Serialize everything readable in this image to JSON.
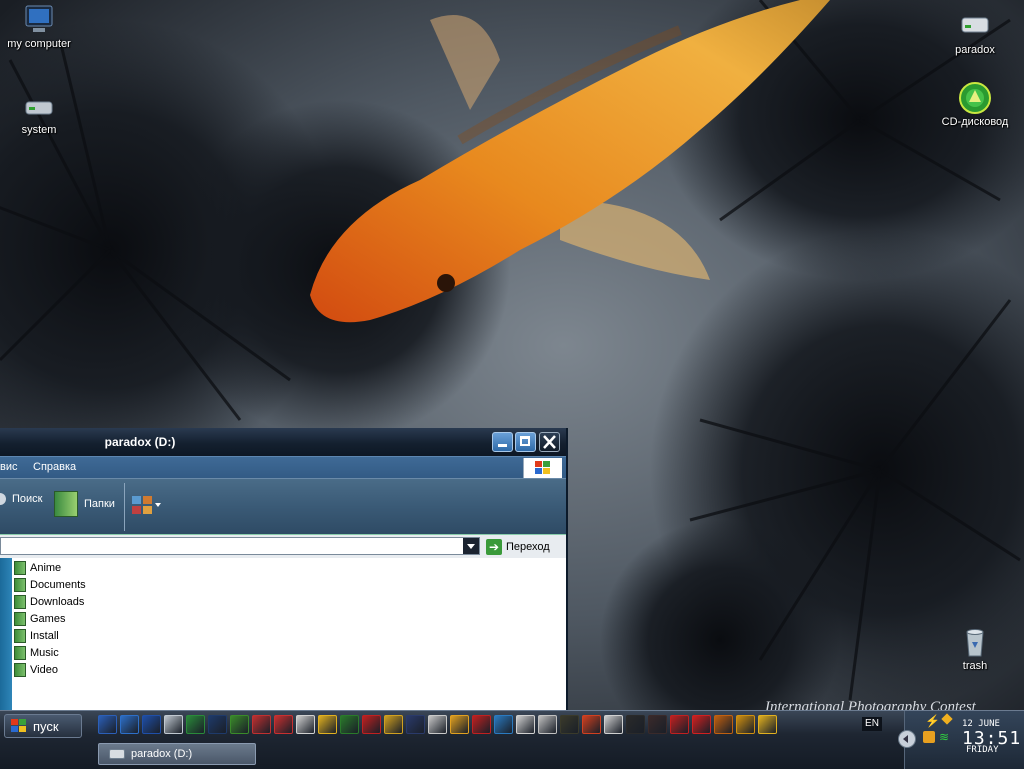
{
  "desktop": {
    "icons": [
      {
        "label": "my computer",
        "icon": "monitor-icon"
      },
      {
        "label": "system",
        "icon": "hard-drive-icon"
      },
      {
        "label": "paradox",
        "icon": "hard-drive-icon"
      },
      {
        "label": "CD-дисковод",
        "icon": "cd-drive-icon"
      },
      {
        "label": "trash",
        "icon": "recycle-bin-icon"
      }
    ],
    "wallpaper_watermark": "International Photography Contest"
  },
  "explorer": {
    "title": "paradox (D:)",
    "menu": [
      "вис",
      "Справка"
    ],
    "toolbar": {
      "search_label": "Поиск",
      "folders_label": "Папки"
    },
    "address": {
      "value": "",
      "go_label": "Переход"
    },
    "folders": [
      "Anime",
      "Documents",
      "Downloads",
      "Games",
      "Install",
      "Music",
      "Video"
    ]
  },
  "taskbar": {
    "start_label": "пуск",
    "language": "EN",
    "task_button_label": "paradox (D:)",
    "clock": {
      "date": "12 JUNE",
      "time": "13:51",
      "day": "FRIDAY"
    },
    "quicklaunch_colors": [
      "#2b5fb8",
      "#2d6fc8",
      "#1f4fa8",
      "#c0c8d0",
      "#2a8a3a",
      "#1e3a6a",
      "#3a8a2a",
      "#c03030",
      "#c83030",
      "#d0d0d0",
      "#e0b020",
      "#2a7a2a",
      "#c02020",
      "#d0a020",
      "#2a3a6a",
      "#c8c8c8",
      "#e0a020",
      "#c02020",
      "#2a7ac0",
      "#d0d0d0",
      "#c0c0c0",
      "#3a3a2a",
      "#d04020",
      "#d0d0d0",
      "#2a2a2a",
      "#3a2a2a",
      "#c02020",
      "#d02020",
      "#c06010",
      "#d09010",
      "#e0b020"
    ]
  },
  "colors": {
    "titlebar_dark": "#0d1724",
    "menubar_blue": "#325a84",
    "content_bg": "#ffffff",
    "fish_orange": "#e07a1a"
  }
}
